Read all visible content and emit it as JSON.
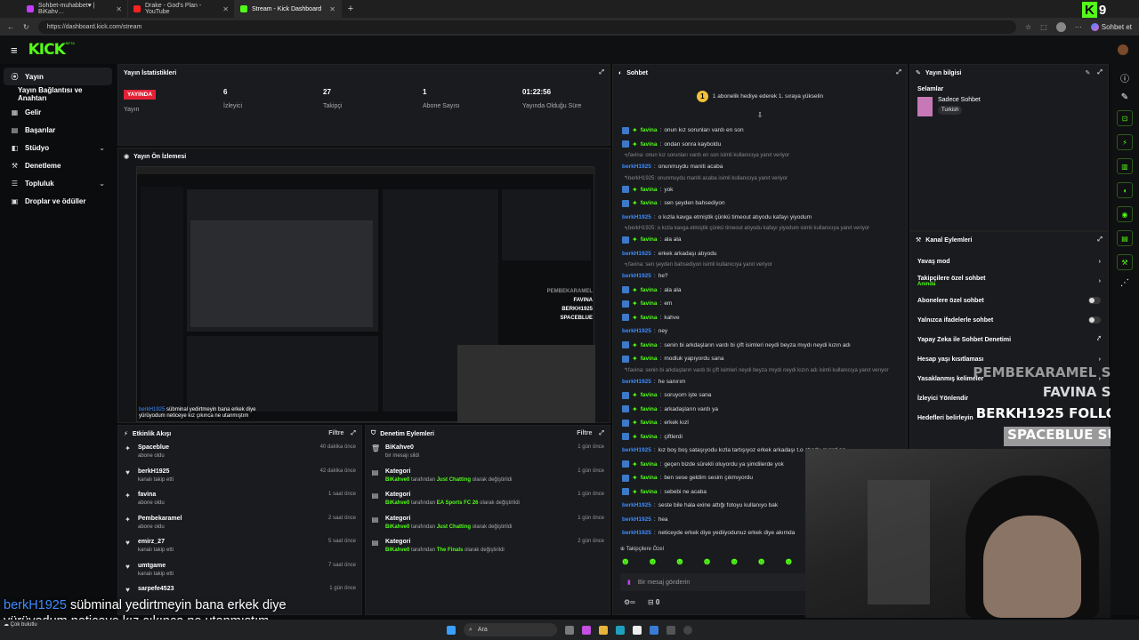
{
  "browser": {
    "tabs": [
      {
        "label": "Sohbet-muhabbet♥ | BiKahv…",
        "color": "#c33cff"
      },
      {
        "label": "Drake - God's Plan - YouTube",
        "color": "#ff2020"
      },
      {
        "label": "Stream - Kick Dashboard",
        "color": "#53fc18"
      }
    ],
    "url": "https://dashboard.kick.com/stream",
    "profile": "Sohbet et",
    "overlay_logo": "K",
    "overlay_count": "9"
  },
  "header": {
    "logo": "KICK",
    "logo_sup": "BETA"
  },
  "sidebar": {
    "items": [
      {
        "label": "Yayın",
        "icon": "broadcast-icon"
      },
      {
        "label": "Yayın Bağlantısı ve Anahtarı",
        "icon": ""
      },
      {
        "label": "Gelir",
        "icon": "revenue-icon"
      },
      {
        "label": "Başarılar",
        "icon": "achievements-icon"
      },
      {
        "label": "Stüdyo",
        "icon": "studio-icon"
      },
      {
        "label": "Denetleme",
        "icon": "moderation-icon"
      },
      {
        "label": "Topluluk",
        "icon": "community-icon"
      },
      {
        "label": "Droplar ve ödüller",
        "icon": "drops-icon"
      }
    ]
  },
  "stats": {
    "title": "Yayın İstatistikleri",
    "items": [
      {
        "value": "YAYINDA",
        "label": "Yayın"
      },
      {
        "value": "6",
        "label": "İzleyici"
      },
      {
        "value": "27",
        "label": "Takipçi"
      },
      {
        "value": "1",
        "label": "Abone Sayısı"
      },
      {
        "value": "01:22:56",
        "label": "Yayında Olduğu Süre"
      }
    ]
  },
  "preview": {
    "title": "Yayın Ön İzlemesi"
  },
  "activity": {
    "title": "Etkinlik Akışı",
    "filter": "Filtre",
    "rows": [
      {
        "name": "Spaceblue",
        "sub": "abone oldu",
        "time": "40 dakika önce",
        "icon": "star"
      },
      {
        "name": "berkH1925",
        "sub": "kanalı takip etti",
        "time": "42 dakika önce",
        "icon": "heart"
      },
      {
        "name": "favina",
        "sub": "abone oldu",
        "time": "1 saat önce",
        "icon": "star"
      },
      {
        "name": "Pembekaramel",
        "sub": "abone oldu",
        "time": "2 saat önce",
        "icon": "star"
      },
      {
        "name": "emirz_27",
        "sub": "kanalı takip etti",
        "time": "5 saat önce",
        "icon": "heart"
      },
      {
        "name": "umtgame",
        "sub": "kanalı takip etti",
        "time": "7 saat önce",
        "icon": "heart"
      },
      {
        "name": "sarpefe4523",
        "sub": "",
        "time": "1 gün önce",
        "icon": "heart"
      }
    ]
  },
  "modlog": {
    "title": "Denetim Eylemleri",
    "filter": "Filtre",
    "rows": [
      {
        "name": "BiKahve0",
        "pre": "",
        "mid": "bir mesajı sildi",
        "cat": "",
        "post": "",
        "time": "1 gün önce"
      },
      {
        "name": "Kategori",
        "pre": "BiKahve0",
        "mid": " tarafından ",
        "cat": "Just Chatting",
        "post": " olarak değiştirildi",
        "time": "1 gün önce"
      },
      {
        "name": "Kategori",
        "pre": "BiKahve0",
        "mid": " tarafından ",
        "cat": "EA Sports FC 26",
        "post": " olarak değiştirildi",
        "time": "1 gün önce"
      },
      {
        "name": "Kategori",
        "pre": "BiKahve0",
        "mid": " tarafından ",
        "cat": "Just Chatting",
        "post": " olarak değiştirildi",
        "time": "1 gün önce"
      },
      {
        "name": "Kategori",
        "pre": "BiKahve0",
        "mid": " tarafından ",
        "cat": "The Finals",
        "post": " olarak değiştirildi",
        "time": "2 gün önce"
      }
    ]
  },
  "chat": {
    "title": "Sohbet",
    "pinned": "1 abonelik hediye ederek 1. sıraya yükselin",
    "pinned_num": "1",
    "messages": [
      {
        "t": "m",
        "u": "favina",
        "c": "g",
        "b": true,
        "txt": "onun kız sorunları vardı en son"
      },
      {
        "t": "m",
        "u": "favina",
        "c": "g",
        "b": true,
        "txt": "ondan sonra kayboldu"
      },
      {
        "t": "r",
        "txt": "favina: onun kız sorunları vardı en son isimli kullanıcıya yanıt veriyor"
      },
      {
        "t": "m",
        "u": "berkH1925",
        "c": "b",
        "b": false,
        "txt": "onunmuydu maniti acaba"
      },
      {
        "t": "r",
        "txt": "berkH1925: onunmuydu maniti acaba isimli kullanıcıya yanıt veriyor"
      },
      {
        "t": "m",
        "u": "favina",
        "c": "g",
        "b": true,
        "txt": "yok"
      },
      {
        "t": "m",
        "u": "favina",
        "c": "g",
        "b": true,
        "txt": "sen şeyden bahsediyon"
      },
      {
        "t": "m",
        "u": "berkH1925",
        "c": "b",
        "b": false,
        "txt": "o kızla kavga etmiştik çünkü timeout atıyodu kafayı yiyodum"
      },
      {
        "t": "r",
        "txt": "berkH1925: o kızla kavga etmiştik çünkü timeout atıyodu kafayı yiyodum isimli kullanıcıya yanıt veriyor"
      },
      {
        "t": "m",
        "u": "favina",
        "c": "g",
        "b": true,
        "txt": "ala ala"
      },
      {
        "t": "m",
        "u": "berkH1925",
        "c": "b",
        "b": false,
        "txt": "erkek arkadaşı atıyodu"
      },
      {
        "t": "r",
        "txt": "favina: sen şeyden bahsediyon isimli kullanıcıya yanıt veriyor"
      },
      {
        "t": "m",
        "u": "berkH1925",
        "c": "b",
        "b": false,
        "txt": "he?"
      },
      {
        "t": "m",
        "u": "favina",
        "c": "g",
        "b": true,
        "txt": "ala ala"
      },
      {
        "t": "m",
        "u": "favina",
        "c": "g",
        "b": true,
        "txt": "em"
      },
      {
        "t": "m",
        "u": "favina",
        "c": "g",
        "b": true,
        "txt": "kahve"
      },
      {
        "t": "m",
        "u": "berkH1925",
        "c": "b",
        "b": false,
        "txt": "ney"
      },
      {
        "t": "m",
        "u": "favina",
        "c": "g",
        "b": true,
        "txt": "senin bi arkdaşların vardı bi çift isimleri neydi beyza mıydı neydi kızın adı"
      },
      {
        "t": "m",
        "u": "favina",
        "c": "g",
        "b": true,
        "txt": "modluk yapıyordu sana"
      },
      {
        "t": "r",
        "txt": "favina: senin bi arkdaşların vardı bi çift isimleri neydi beyza mıydı neydi kızın adı isimli kullanıcıya yanıt verıyor"
      },
      {
        "t": "m",
        "u": "berkH1925",
        "c": "b",
        "b": false,
        "txt": "he sanırım"
      },
      {
        "t": "m",
        "u": "favina",
        "c": "g",
        "b": true,
        "txt": "soruyorn işte sana"
      },
      {
        "t": "m",
        "u": "favina",
        "c": "g",
        "b": true,
        "txt": "arkadaşların vardı ya"
      },
      {
        "t": "m",
        "u": "favina",
        "c": "g",
        "b": true,
        "txt": "erkek kızl"
      },
      {
        "t": "m",
        "u": "favina",
        "c": "g",
        "b": true,
        "txt": "çiftlerdi"
      },
      {
        "t": "m",
        "u": "berkH1925",
        "c": "b",
        "b": false,
        "txt": "kız boş boş sataşıyodu kızla tartışıyoz erkek arkadaşı t.o atıodu guard aq"
      },
      {
        "t": "m",
        "u": "favina",
        "c": "g",
        "b": true,
        "txt": "geçen bizde sürekli oluyordu ya şimdilerde yok"
      },
      {
        "t": "m",
        "u": "favina",
        "c": "g",
        "b": true,
        "txt": "ben sese geldim sesim çıkmıyordu"
      },
      {
        "t": "m",
        "u": "favina",
        "c": "g",
        "b": true,
        "txt": "sebebi ne acaba"
      },
      {
        "t": "m",
        "u": "berkH1925",
        "c": "b",
        "b": false,
        "txt": "seste bile hala exine attığı fotoyu kullanıyo bak"
      },
      {
        "t": "m",
        "u": "berkH1925",
        "c": "b",
        "b": false,
        "txt": "hea"
      },
      {
        "t": "m",
        "u": "berkH1925",
        "c": "b",
        "b": false,
        "txt": "neticeyde erkek diye yediiyodunuz erkek diye akımda"
      },
      {
        "t": "m",
        "u": "berkH1925",
        "c": "b",
        "b": false,
        "txt": "sübminal yedirtmeyin bana erkek diye yürüyodum neti"
      }
    ],
    "followers_label": "Takipçilere Özel",
    "input_placeholder": "Bir mesaj gönderin",
    "counter": "0"
  },
  "streaminfo": {
    "title": "Yayın bilgisi",
    "stream_title": "Selamlar",
    "category": "Sadece Sohbet",
    "language": "Turkish"
  },
  "channel_actions": {
    "title": "Kanal Eylemleri",
    "items": [
      {
        "label": "Yavaş mod",
        "sub": "",
        "ctrl": "arrow"
      },
      {
        "label": "Takipçilere özel sohbet",
        "sub": "Anında",
        "ctrl": "arrow"
      },
      {
        "label": "Abonelere özel sohbet",
        "sub": "",
        "ctrl": "toggle"
      },
      {
        "label": "Yalnızca ifadelerle sohbet",
        "sub": "",
        "ctrl": "toggle"
      },
      {
        "label": "Yapay Zeka ile Sohbet Denetimi",
        "sub": "",
        "ctrl": "external"
      },
      {
        "label": "Hesap yaşı kısıtlaması",
        "sub": "",
        "ctrl": "arrow"
      },
      {
        "label": "Yasaklanmış kelimeler",
        "sub": "",
        "ctrl": "arrow"
      },
      {
        "label": "İzleyici Yönlendir",
        "sub": "",
        "ctrl": ""
      },
      {
        "label": "Hedefleri belirleyin",
        "sub": "",
        "ctrl": ""
      }
    ]
  },
  "overlay_alerts": [
    {
      "name": "PEMBEKARAMEL",
      "kind": "SUB",
      "color": "#9a9a9a"
    },
    {
      "name": "FAVINA",
      "kind": "SUB",
      "color": "#d8d8d8"
    },
    {
      "name": "BERKH1925",
      "kind": "FOLLOW",
      "color": "#ffffff"
    },
    {
      "name": "SPACEBLUE",
      "kind": "SUB",
      "color": "#ffffff"
    }
  ],
  "caption": {
    "user": "berkH1925",
    "line1": "sübminal yedirtmeyin bana erkek diye",
    "line2": "yürüyodum neticeye kız çıkınca ne utanmıştım"
  },
  "weather": {
    "text": "Çok bulutlu"
  },
  "taskbar": {
    "search": "Ara"
  },
  "colors": {
    "accent": "#53fc18",
    "live": "#e32236",
    "user_blue": "#3d8cff"
  }
}
